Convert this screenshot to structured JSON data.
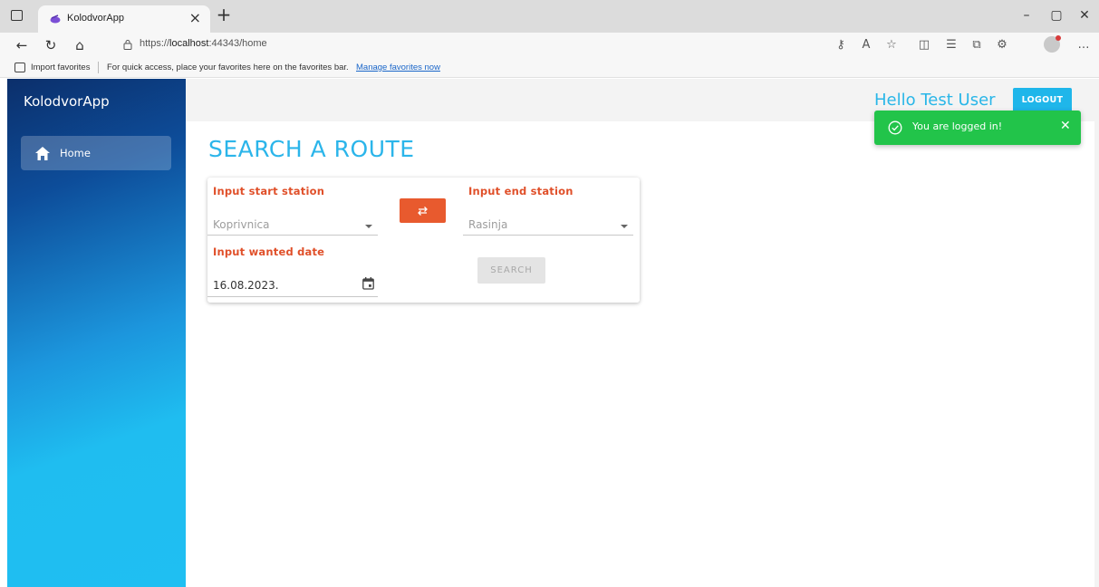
{
  "browser": {
    "tab_title": "KolodvorApp",
    "url_prefix": "https://",
    "url_host": "localhost",
    "url_rest": ":44343/home",
    "favorites_bar": {
      "import_label": "Import favorites",
      "hint": "For quick access, place your favorites here on the favorites bar.",
      "manage_link": "Manage favorites now"
    }
  },
  "sidebar": {
    "brand": "KolodvorApp",
    "items": [
      {
        "label": "Home",
        "icon": "home-icon",
        "active": true
      }
    ]
  },
  "header": {
    "greeting": "Hello Test User",
    "logout_label": "LOGOUT"
  },
  "toast": {
    "message": "You are logged in!",
    "close_glyph": "✕",
    "color": "#22c44a"
  },
  "page": {
    "title": "SEARCH A ROUTE"
  },
  "search_form": {
    "start_label": "Input start station",
    "start_value": "Koprivnica",
    "end_label": "Input end station",
    "end_value": "Rasinja",
    "date_label": "Input wanted date",
    "date_value": "16.08.2023.",
    "search_label": "SEARCH"
  },
  "colors": {
    "accent": "#2bb5ea",
    "label_orange": "#e0502a",
    "swap_button": "#e85a2e",
    "logout_button": "#1fb6ea"
  }
}
